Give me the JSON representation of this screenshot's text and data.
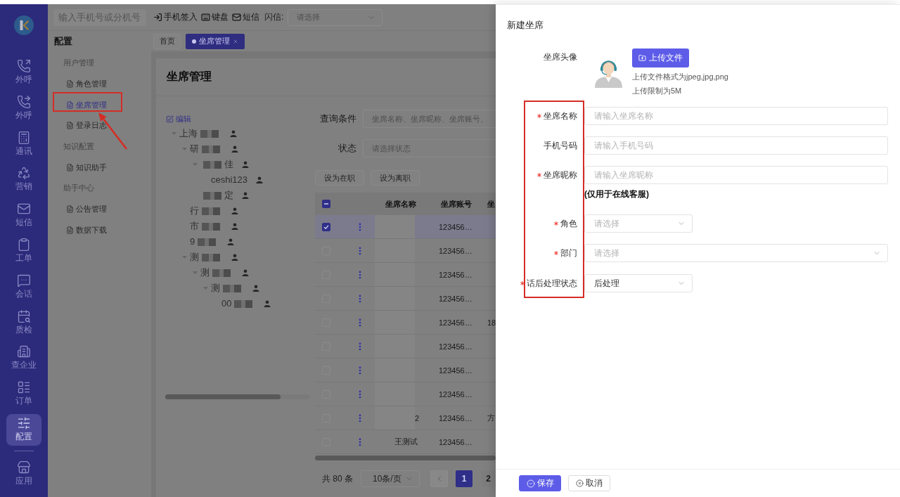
{
  "nav": {
    "items": [
      {
        "kind": "call",
        "label": "外呼",
        "selected": false
      },
      {
        "kind": "call-forward",
        "label": "外呼",
        "selected": false
      },
      {
        "kind": "contacts",
        "label": "通讯",
        "selected": false
      },
      {
        "kind": "marketing",
        "label": "营销",
        "selected": false
      },
      {
        "kind": "sms",
        "label": "短信",
        "selected": false
      },
      {
        "kind": "ticket",
        "label": "工单",
        "selected": false
      },
      {
        "kind": "chat",
        "label": "会话",
        "selected": false
      },
      {
        "kind": "inspection",
        "label": "质检",
        "selected": false
      },
      {
        "kind": "company",
        "label": "查企业",
        "selected": false
      },
      {
        "kind": "order",
        "label": "订单",
        "selected": false
      },
      {
        "kind": "settings",
        "label": "配置",
        "selected": true
      }
    ],
    "footer_items": [
      {
        "kind": "apps",
        "label": "应用",
        "selected": false
      }
    ]
  },
  "topbar": {
    "dial_placeholder": "输入手机号或分机号",
    "actions": [
      {
        "kind": "sign-in",
        "label": "手机签入"
      },
      {
        "kind": "keyboard",
        "label": "键盘"
      },
      {
        "kind": "mail",
        "label": "短信"
      }
    ],
    "flash_label": "闪信:",
    "flash_placeholder": "请选择"
  },
  "section_title": "配置",
  "tabs": [
    {
      "label": "首页",
      "selected": false,
      "closable": false
    },
    {
      "label": "坐席管理",
      "selected": true,
      "closable": true
    }
  ],
  "menu": {
    "groups": [
      {
        "title": "用户管理",
        "items": [
          {
            "label": "角色管理",
            "selected": false
          },
          {
            "label": "坐席管理",
            "selected": true
          },
          {
            "label": "登录日志",
            "selected": false
          }
        ]
      },
      {
        "title": "知识配置",
        "items": [
          {
            "label": "知识助手",
            "selected": false
          }
        ]
      },
      {
        "title": "助手中心",
        "items": [
          {
            "label": "公告管理",
            "selected": false
          },
          {
            "label": "数据下载",
            "selected": false
          }
        ]
      }
    ]
  },
  "page": {
    "title": "坐席管理",
    "tree": {
      "edit_label": "编辑",
      "nodes": [
        {
          "label": "上海",
          "mask_before": false,
          "mask_after": true,
          "expanded": true,
          "children": [
            {
              "label": "研",
              "mask_before": false,
              "mask_after": true,
              "expanded": true,
              "children": [
                {
                  "label": "佳",
                  "mask_before": true,
                  "mask_after": false,
                  "expanded": true,
                  "children": [
                    {
                      "label": "ceshi123",
                      "mask_before": false,
                      "mask_after": false
                    }
                  ]
                },
                {
                  "label": "定",
                  "mask_before": true,
                  "mask_after": false
                }
              ]
            },
            {
              "label": "行",
              "mask_before": false,
              "mask_after": true
            },
            {
              "label": "市",
              "mask_before": false,
              "mask_after": true
            },
            {
              "label": "9",
              "mask_before": false,
              "mask_after": true
            },
            {
              "label": "测",
              "mask_before": false,
              "mask_after": true,
              "expanded": true,
              "children": [
                {
                  "label": "测",
                  "mask_before": false,
                  "mask_after": true,
                  "expanded": true,
                  "children": [
                    {
                      "label": "测",
                      "mask_before": false,
                      "mask_after": true,
                      "expanded": true,
                      "children": [
                        {
                          "label": "00",
                          "mask_before": false,
                          "mask_after": true
                        }
                      ]
                    }
                  ]
                }
              ]
            }
          ]
        }
      ]
    },
    "filters": [
      {
        "label": "查询条件",
        "placeholder": "坐席名称、坐席昵称、坐席账号、"
      },
      {
        "label": "状态",
        "placeholder": "请选择状态"
      }
    ],
    "bulk_actions": [
      "设为在职",
      "设为离职"
    ],
    "table": {
      "header_checkbox": {
        "indeterminate": true
      },
      "columns": [
        "坐席名称",
        "坐席账号",
        "坐"
      ],
      "rows": [
        {
          "selected": true,
          "redacted": true,
          "account": "123456…"
        },
        {
          "selected": false,
          "redacted": true,
          "account": "123456…"
        },
        {
          "selected": false,
          "redacted": true,
          "account": "123456…"
        },
        {
          "selected": false,
          "redacted": true,
          "account": "123456…"
        },
        {
          "selected": false,
          "redacted": true,
          "account": "123456…",
          "column_3": "18"
        },
        {
          "selected": false,
          "redacted": true,
          "account": "123456…"
        },
        {
          "selected": false,
          "redacted": true,
          "account": "123456…"
        },
        {
          "selected": false,
          "redacted": true,
          "account": "123456…"
        },
        {
          "selected": false,
          "redacted": true,
          "name": "2",
          "account": "123456…",
          "column_3": "方"
        },
        {
          "selected": false,
          "redacted": false,
          "name": "王测试",
          "account": "123456…"
        }
      ]
    },
    "pagination": {
      "total": "共 80 条",
      "page_size": "10条/页",
      "prev_disabled": true,
      "pages": [
        {
          "label": "1",
          "selected": true
        },
        {
          "label": "2",
          "selected": false
        }
      ]
    }
  },
  "drawer": {
    "title": "新建坐席",
    "avatar_label": "坐席头像",
    "upload_button": "上传文件",
    "upload_hints": [
      "上传文件格式为jpeg,jpg,png",
      "上传限制为5M"
    ],
    "fields": [
      {
        "kind": "input",
        "label": "坐席名称",
        "required": true,
        "placeholder": "请输入坐席名称"
      },
      {
        "kind": "input",
        "label": "手机号码",
        "required": false,
        "placeholder": "请输入手机号码"
      },
      {
        "kind": "input",
        "label": "坐席昵称",
        "required": true,
        "placeholder": "请输入坐席昵称",
        "note": "(仅用于在线客服)"
      },
      {
        "kind": "select",
        "label": "角色",
        "required": true,
        "placeholder": "请选择"
      },
      {
        "kind": "tree-select",
        "label": "部门",
        "required": true,
        "placeholder": "请选择"
      },
      {
        "kind": "select",
        "label": "话后处理状态",
        "required": true,
        "value": "后处理"
      }
    ],
    "buttons": [
      {
        "kind": "primary",
        "label": "保存"
      },
      {
        "kind": "default",
        "label": "取消"
      }
    ]
  }
}
